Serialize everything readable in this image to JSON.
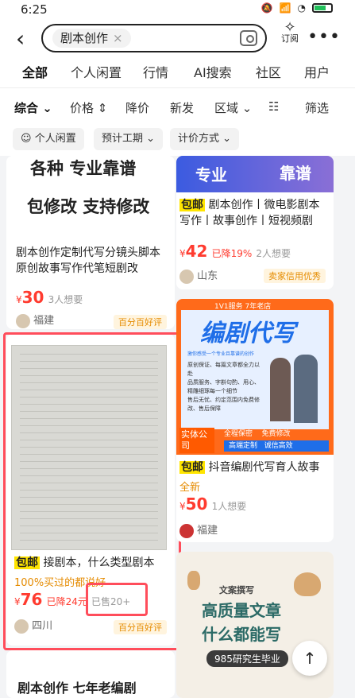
{
  "status": {
    "time": "6:25"
  },
  "search": {
    "query": "剧本创作",
    "subscribe_label": "订阅"
  },
  "tabs": [
    "全部",
    "个人闲置",
    "行情",
    "AI搜索",
    "社区",
    "用户"
  ],
  "sort": [
    "综合",
    "价格",
    "降价",
    "新发",
    "区域",
    "筛选"
  ],
  "filters": [
    "个人闲置",
    "预计工期",
    "计价方式"
  ],
  "left": {
    "top_banner": [
      "各种 专业靠谱",
      "包修改 支持修改"
    ],
    "item1": {
      "title": "剧本创作定制代写分镜头脚本原创故事写作代笔短剧改",
      "price": "30",
      "wants": "3人想要",
      "location": "福建",
      "badge": "百分百好评"
    },
    "item2": {
      "badge_text": "包邮",
      "title": "接剧本，什么类型剧本",
      "subtitle": "100%买过的都说好",
      "price": "76",
      "discount": "已降24元",
      "sold": "已售20+",
      "location": "四川",
      "badge": "百分百好评"
    },
    "item3": {
      "title": "剧本创作 七年老编剧"
    }
  },
  "right": {
    "banner1_text": [
      "专业",
      "靠谱"
    ],
    "item1": {
      "badge_text": "包邮",
      "title": "剧本创作丨微电影剧本写作丨故事创作丨短视频剧",
      "price": "42",
      "discount": "已降19%",
      "wants": "2人想要",
      "location": "山东",
      "badge": "卖家信用优秀"
    },
    "item2": {
      "banner_top": "1V1服务  7年老店",
      "banner_big": "编剧代写",
      "banner_sub": "激你感受一个专业且靠谱的创作",
      "banner_points": [
        "原创保证、每篇文章都全力以赴",
        "品质服务、字斟句酌、用心、精雕细琢每一个细节",
        "售后无忧、约定范围内免费修改、售后保障"
      ],
      "banner_bottom": [
        "全程保密",
        "免费修改",
        "高端定制",
        "诚信高效"
      ],
      "store_label": "实体公司",
      "badge_text": "包邮",
      "title": "抖音编剧代写育人故事",
      "subtitle": "全新",
      "price": "50",
      "wants": "1人想要",
      "location": "福建"
    },
    "item3": {
      "banner_title": "文案撰写",
      "big1": "高质量文章",
      "big2": "什么都能写",
      "tag": "985研究生毕业"
    }
  },
  "colors": {
    "accent_yellow": "#ffe500",
    "price_red": "#ff3b2f",
    "highlight_red": "#ff4d5b",
    "banner_blue": "#2d7de6",
    "banner_orange": "#ff6a1a"
  }
}
